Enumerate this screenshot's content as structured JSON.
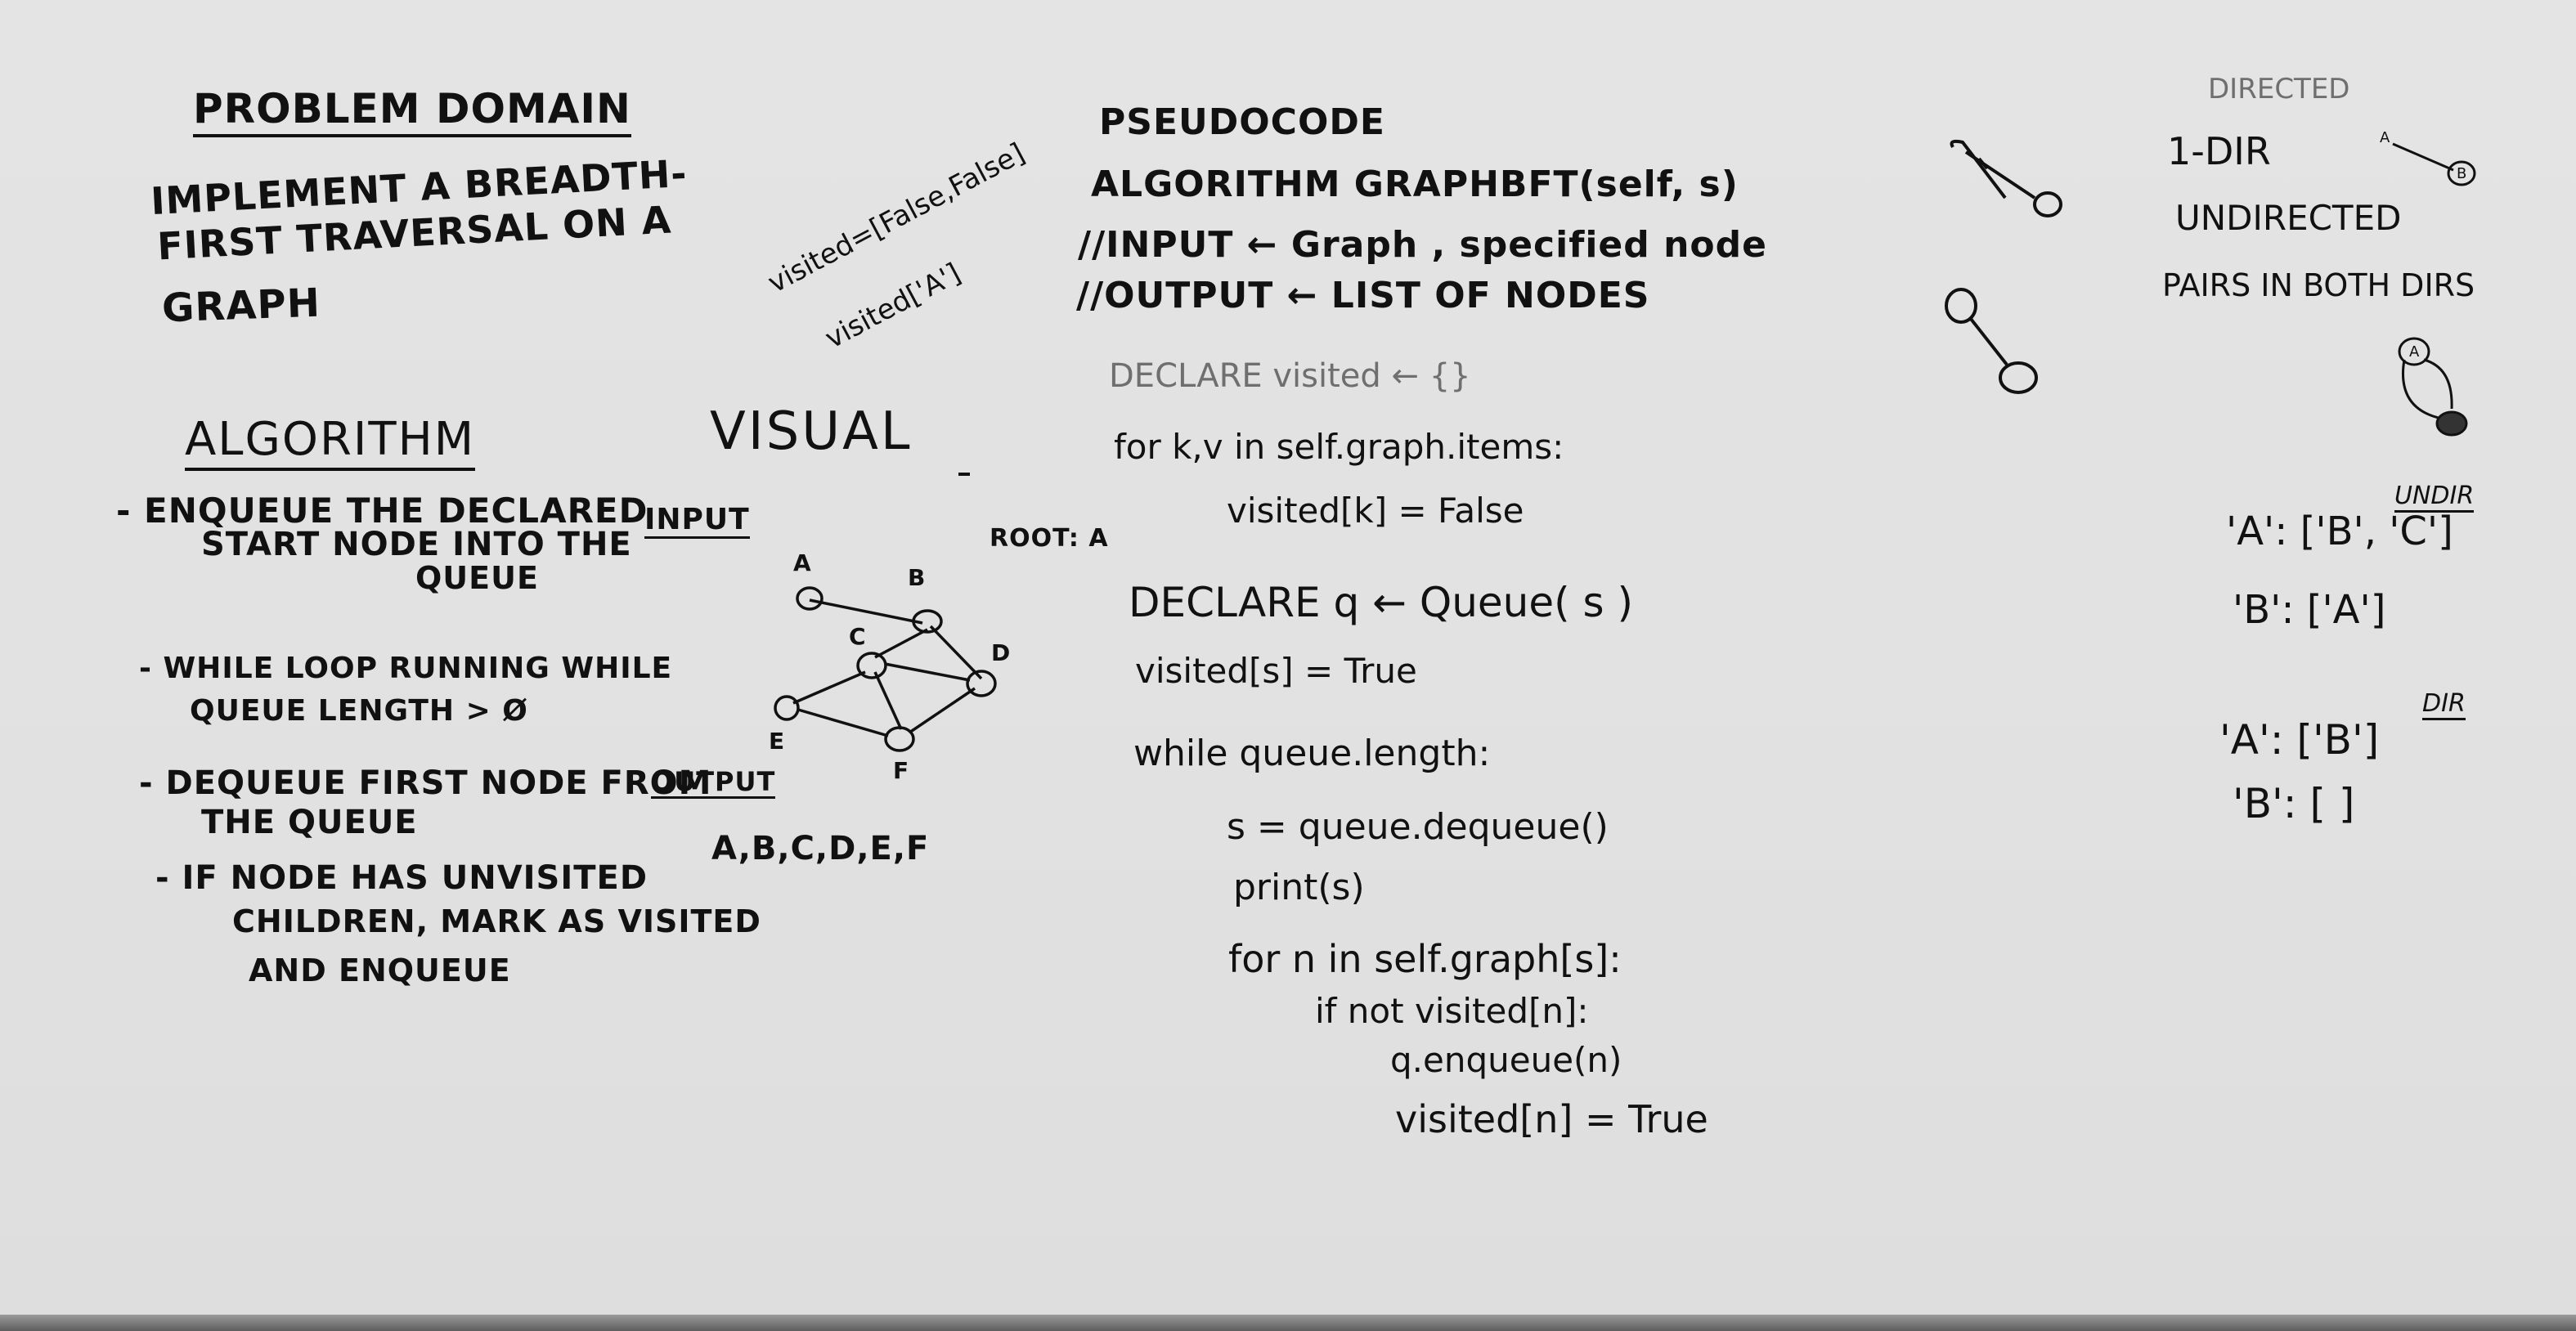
{
  "problem": {
    "heading": "PROBLEM DOMAIN",
    "lines": [
      "IMPLEMENT A BREADTH-",
      "FIRST TRAVERSAL ON A",
      "GRAPH"
    ]
  },
  "notes": {
    "visited_arr": "visited=[False,False]",
    "visited_a": "visited['A']"
  },
  "algorithm": {
    "heading": "ALGORITHM",
    "step1": [
      "- ENQUEUE THE DECLARED",
      "START NODE INTO THE",
      "QUEUE"
    ],
    "step2": [
      "- WHILE LOOP RUNNING WHILE",
      "QUEUE LENGTH > Ø"
    ],
    "step3": [
      "- DEQUEUE FIRST NODE FROM",
      "THE QUEUE"
    ],
    "step4": [
      "- IF NODE HAS UNVISITED",
      "CHILDREN, MARK AS VISITED",
      "AND ENQUEUE"
    ]
  },
  "visual": {
    "heading": "VISUAL",
    "input_label": "INPUT",
    "output_label": "OUTPUT",
    "root_label": "ROOT: A",
    "output_value": "A,B,C,D,E,F",
    "nodes": [
      {
        "id": "A",
        "label": "A"
      },
      {
        "id": "B",
        "label": "B"
      },
      {
        "id": "C",
        "label": "C"
      },
      {
        "id": "D",
        "label": "D"
      },
      {
        "id": "E",
        "label": "E"
      },
      {
        "id": "F",
        "label": "F"
      }
    ]
  },
  "pseudocode": {
    "heading": "PSEUDOCODE",
    "signature": "ALGORITHM GRAPHBFT(self, s)",
    "input": "//INPUT ← Graph , specified node",
    "output": "//OUTPUT ← LIST OF NODES",
    "declare_visited": "DECLARE visited ← {}",
    "for_items": "for k,v in self.graph.items:",
    "set_false": "visited[k] = False",
    "declare_q": "DECLARE q ← Queue( s )",
    "set_true_s": "visited[s] = True",
    "while_line": "while queue.length:",
    "dequeue": "s = queue.dequeue()",
    "print": "print(s)",
    "for_n": "for n in self.graph[s]:",
    "if_not": "if not visited[n]:",
    "enqueue": "q.enqueue(n)",
    "set_true_n": "visited[n] = True"
  },
  "side_notes": {
    "directed": "DIRECTED",
    "one_dir": "1-DIR",
    "undirected": "UNDIRECTED",
    "pairs": "PAIRS IN BOTH DIRS",
    "node_a": "A",
    "node_b": "B",
    "undir_a": "'A': ['B', 'C']",
    "undir_b": "'B': ['A']",
    "undir_tag": "UNDIR",
    "dir_a": "'A': ['B']",
    "dir_b": "'B': [ ]",
    "dir_tag": "DIR"
  }
}
